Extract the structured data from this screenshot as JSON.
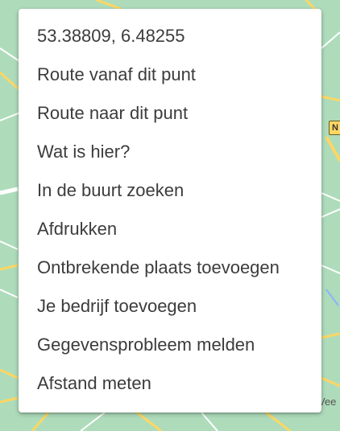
{
  "context_menu": {
    "items": [
      {
        "label": "53.38809, 6.48255"
      },
      {
        "label": "Route vanaf dit punt"
      },
      {
        "label": "Route naar dit punt"
      },
      {
        "label": "Wat is hier?"
      },
      {
        "label": "In de buurt zoeken"
      },
      {
        "label": "Afdrukken"
      },
      {
        "label": "Ontbrekende plaats toevoegen"
      },
      {
        "label": "Je bedrijf toevoegen"
      },
      {
        "label": "Gegevensprobleem melden"
      },
      {
        "label": "Afstand meten"
      }
    ]
  },
  "map": {
    "road_sign": "N",
    "place_label": "Vee",
    "colors": {
      "land": "#aedcbb",
      "road": "#fdd663",
      "minor_road": "#ffffff"
    }
  }
}
